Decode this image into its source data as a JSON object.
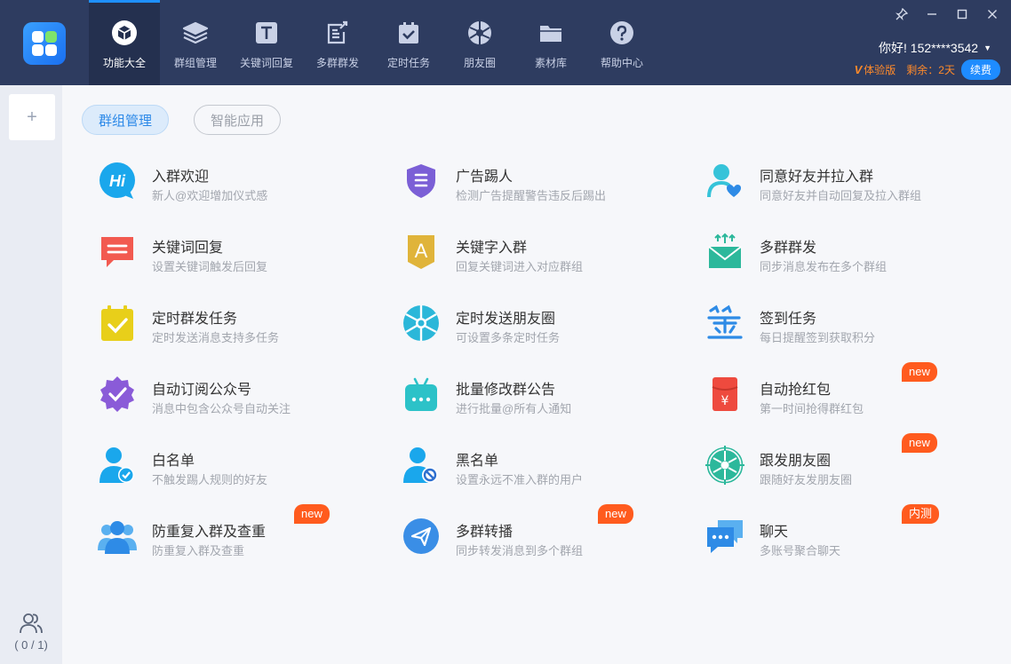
{
  "nav": {
    "items": [
      {
        "label": "功能大全",
        "icon": "cube-icon",
        "active": true
      },
      {
        "label": "群组管理",
        "icon": "layers-icon"
      },
      {
        "label": "关键词回复",
        "icon": "text-t-icon"
      },
      {
        "label": "多群群发",
        "icon": "edit-share-icon"
      },
      {
        "label": "定时任务",
        "icon": "calendar-check-icon"
      },
      {
        "label": "朋友圈",
        "icon": "aperture-icon"
      },
      {
        "label": "素材库",
        "icon": "folder-icon"
      },
      {
        "label": "帮助中心",
        "icon": "help-icon"
      }
    ]
  },
  "window": {
    "pin": "pin-icon",
    "minimize": "minimize-icon",
    "maximize": "maximize-icon",
    "close": "close-icon"
  },
  "user": {
    "greeting": "你好! 152****3542",
    "version": "体验版",
    "remaining": "剩余：2天",
    "renew": "续费"
  },
  "sidebar": {
    "add": "+",
    "account_count": "( 0 / 1)"
  },
  "tabs": [
    {
      "label": "群组管理",
      "active": true
    },
    {
      "label": "智能应用",
      "active": false
    }
  ],
  "features": [
    {
      "title": "入群欢迎",
      "desc": "新人@欢迎增加仪式感",
      "icon": "hi-bubble-icon"
    },
    {
      "title": "广告踢人",
      "desc": "检测广告提醒警告违反后踢出",
      "icon": "shield-icon"
    },
    {
      "title": "同意好友并拉入群",
      "desc": "同意好友并自动回复及拉入群组",
      "icon": "user-heart-icon"
    },
    {
      "title": "关键词回复",
      "desc": "设置关键词触发后回复",
      "icon": "message-lines-icon"
    },
    {
      "title": "关键字入群",
      "desc": "回复关键词进入对应群组",
      "icon": "letter-a-badge-icon"
    },
    {
      "title": "多群群发",
      "desc": "同步消息发布在多个群组",
      "icon": "mail-share-icon"
    },
    {
      "title": "定时群发任务",
      "desc": "定时发送消息支持多任务",
      "icon": "calendar-check-icon"
    },
    {
      "title": "定时发送朋友圈",
      "desc": "可设置多条定时任务",
      "icon": "aperture-icon"
    },
    {
      "title": "签到任务",
      "desc": "每日提醒签到获取积分",
      "icon": "sign-in-icon"
    },
    {
      "title": "自动订阅公众号",
      "desc": "消息中包含公众号自动关注",
      "icon": "check-badge-icon",
      "badge": ""
    },
    {
      "title": "批量修改群公告",
      "desc": "进行批量@所有人通知",
      "icon": "robot-icon"
    },
    {
      "title": "自动抢红包",
      "desc": "第一时间抢得群红包",
      "icon": "red-envelope-icon",
      "badge": "new"
    },
    {
      "title": "白名单",
      "desc": "不触发踢人规则的好友",
      "icon": "user-check-icon"
    },
    {
      "title": "黑名单",
      "desc": "设置永远不准入群的用户",
      "icon": "user-block-icon"
    },
    {
      "title": "跟发朋友圈",
      "desc": "跟随好友发朋友圈",
      "icon": "target-aperture-icon",
      "badge": "new"
    },
    {
      "title": "防重复入群及查重",
      "desc": "防重复入群及查重",
      "icon": "users-group-icon",
      "badge": "new"
    },
    {
      "title": "多群转播",
      "desc": "同步转发消息到多个群组",
      "icon": "paper-plane-icon",
      "badge": "new"
    },
    {
      "title": "聊天",
      "desc": "多账号聚合聊天",
      "icon": "chat-bubbles-icon",
      "badge": "内测"
    }
  ]
}
